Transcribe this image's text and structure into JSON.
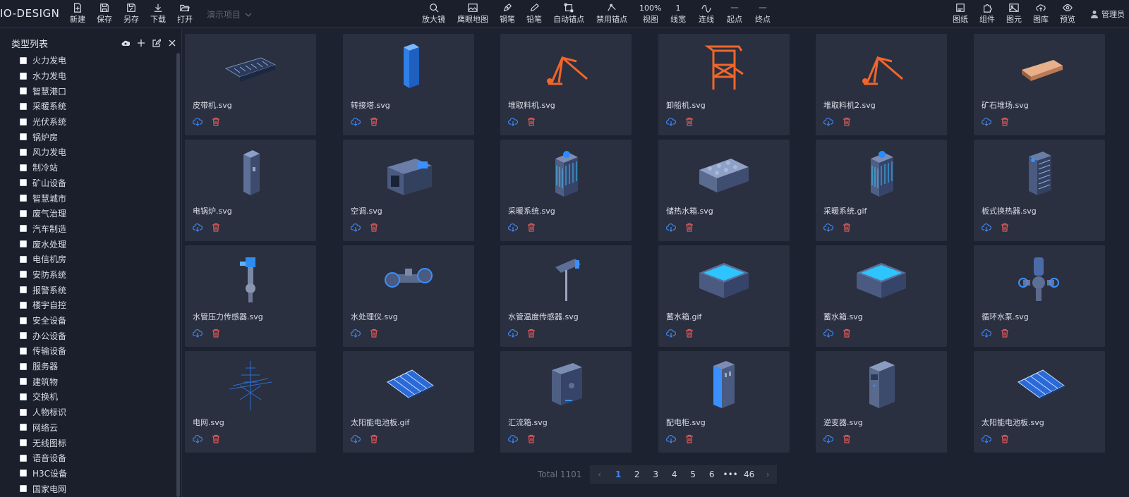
{
  "app": {
    "logo": "IO-DESIGN",
    "project": "演示项目",
    "user": "管理员"
  },
  "toolbar_left": [
    {
      "label": "新建",
      "icon": "file-plus-icon"
    },
    {
      "label": "保存",
      "icon": "save-icon"
    },
    {
      "label": "另存",
      "icon": "save-as-icon"
    },
    {
      "label": "下载",
      "icon": "download-icon"
    },
    {
      "label": "打开",
      "icon": "folder-open-icon"
    }
  ],
  "toolbar_center": [
    {
      "label": "放大镜",
      "icon": "magnifier-icon"
    },
    {
      "label": "鹰眼地图",
      "icon": "image-map-icon"
    },
    {
      "label": "钢笔",
      "icon": "pen-icon"
    },
    {
      "label": "铅笔",
      "icon": "pencil-icon"
    },
    {
      "label": "自动锚点",
      "icon": "anchor-box-icon"
    },
    {
      "label": "禁用锚点",
      "icon": "anchor-disable-icon"
    },
    {
      "label": "视图",
      "value": "100%"
    },
    {
      "label": "线宽",
      "value": "1"
    },
    {
      "label": "连线",
      "icon": "curve-line-icon"
    },
    {
      "label": "起点",
      "icon": "line-start-icon"
    },
    {
      "label": "终点",
      "icon": "line-end-icon"
    }
  ],
  "toolbar_right": [
    {
      "label": "图纸",
      "icon": "drawing-icon"
    },
    {
      "label": "组件",
      "icon": "puzzle-icon"
    },
    {
      "label": "图元",
      "icon": "image-icon"
    },
    {
      "label": "图库",
      "icon": "cloud-upload-icon"
    },
    {
      "label": "预览",
      "icon": "eye-icon"
    }
  ],
  "sidebar": {
    "title": "类型列表",
    "categories": [
      "火力发电",
      "水力发电",
      "智慧港口",
      "采暖系统",
      "光伏系统",
      "锅炉房",
      "风力发电",
      "制冷站",
      "矿山设备",
      "智慧城市",
      "废气治理",
      "汽车制造",
      "废水处理",
      "电信机房",
      "安防系统",
      "报警系统",
      "楼宇自控",
      "安全设备",
      "办公设备",
      "传输设备",
      "服务器",
      "建筑物",
      "交换机",
      "人物标识",
      "网络云",
      "无线图标",
      "语音设备",
      "H3C设备",
      "国家电网"
    ]
  },
  "grid": {
    "items": [
      {
        "name": "皮带机.svg",
        "icon": "belt-conveyor-icon"
      },
      {
        "name": "转接塔.svg",
        "icon": "transfer-tower-icon"
      },
      {
        "name": "堆取料机.svg",
        "icon": "stacker-reclaimer-icon"
      },
      {
        "name": "卸船机.svg",
        "icon": "ship-unloader-icon"
      },
      {
        "name": "堆取料机2.svg",
        "icon": "stacker-reclaimer-icon"
      },
      {
        "name": "矿石堆场.svg",
        "icon": "ore-yard-icon"
      },
      {
        "name": "电锅炉.svg",
        "icon": "electric-boiler-icon"
      },
      {
        "name": "空调.svg",
        "icon": "air-conditioner-icon"
      },
      {
        "name": "采暖系统.svg",
        "icon": "heating-unit-icon"
      },
      {
        "name": "储热水箱.svg",
        "icon": "heat-storage-tank-icon"
      },
      {
        "name": "采暖系统.gif",
        "icon": "heating-unit-icon"
      },
      {
        "name": "板式换热器.svg",
        "icon": "plate-heat-exchanger-icon"
      },
      {
        "name": "水管压力传感器.svg",
        "icon": "pressure-sensor-icon"
      },
      {
        "name": "水处理仪.svg",
        "icon": "water-treatment-icon"
      },
      {
        "name": "水管温度传感器.svg",
        "icon": "temperature-sensor-icon"
      },
      {
        "name": "蓄水箱.gif",
        "icon": "water-tank-icon"
      },
      {
        "name": "蓄水箱.svg",
        "icon": "water-tank-icon"
      },
      {
        "name": "循环水泵.svg",
        "icon": "circulating-pump-icon"
      },
      {
        "name": "电网.svg",
        "icon": "power-grid-icon"
      },
      {
        "name": "太阳能电池板.gif",
        "icon": "solar-panel-icon"
      },
      {
        "name": "汇流箱.svg",
        "icon": "combiner-box-icon"
      },
      {
        "name": "配电柜.svg",
        "icon": "distribution-cabinet-icon"
      },
      {
        "name": "逆变器.svg",
        "icon": "inverter-icon"
      },
      {
        "name": "太阳能电池板.svg",
        "icon": "solar-panel-icon"
      }
    ]
  },
  "pagination": {
    "total": "Total 1101",
    "pages": [
      "1",
      "2",
      "3",
      "4",
      "5",
      "6",
      "•••",
      "46"
    ],
    "current": "1"
  },
  "colors": {
    "accent": "#3d86f2",
    "danger": "#e05a5a",
    "card": "#2a3040",
    "orange": "#f0662a",
    "blue": "#2e8cf0"
  }
}
